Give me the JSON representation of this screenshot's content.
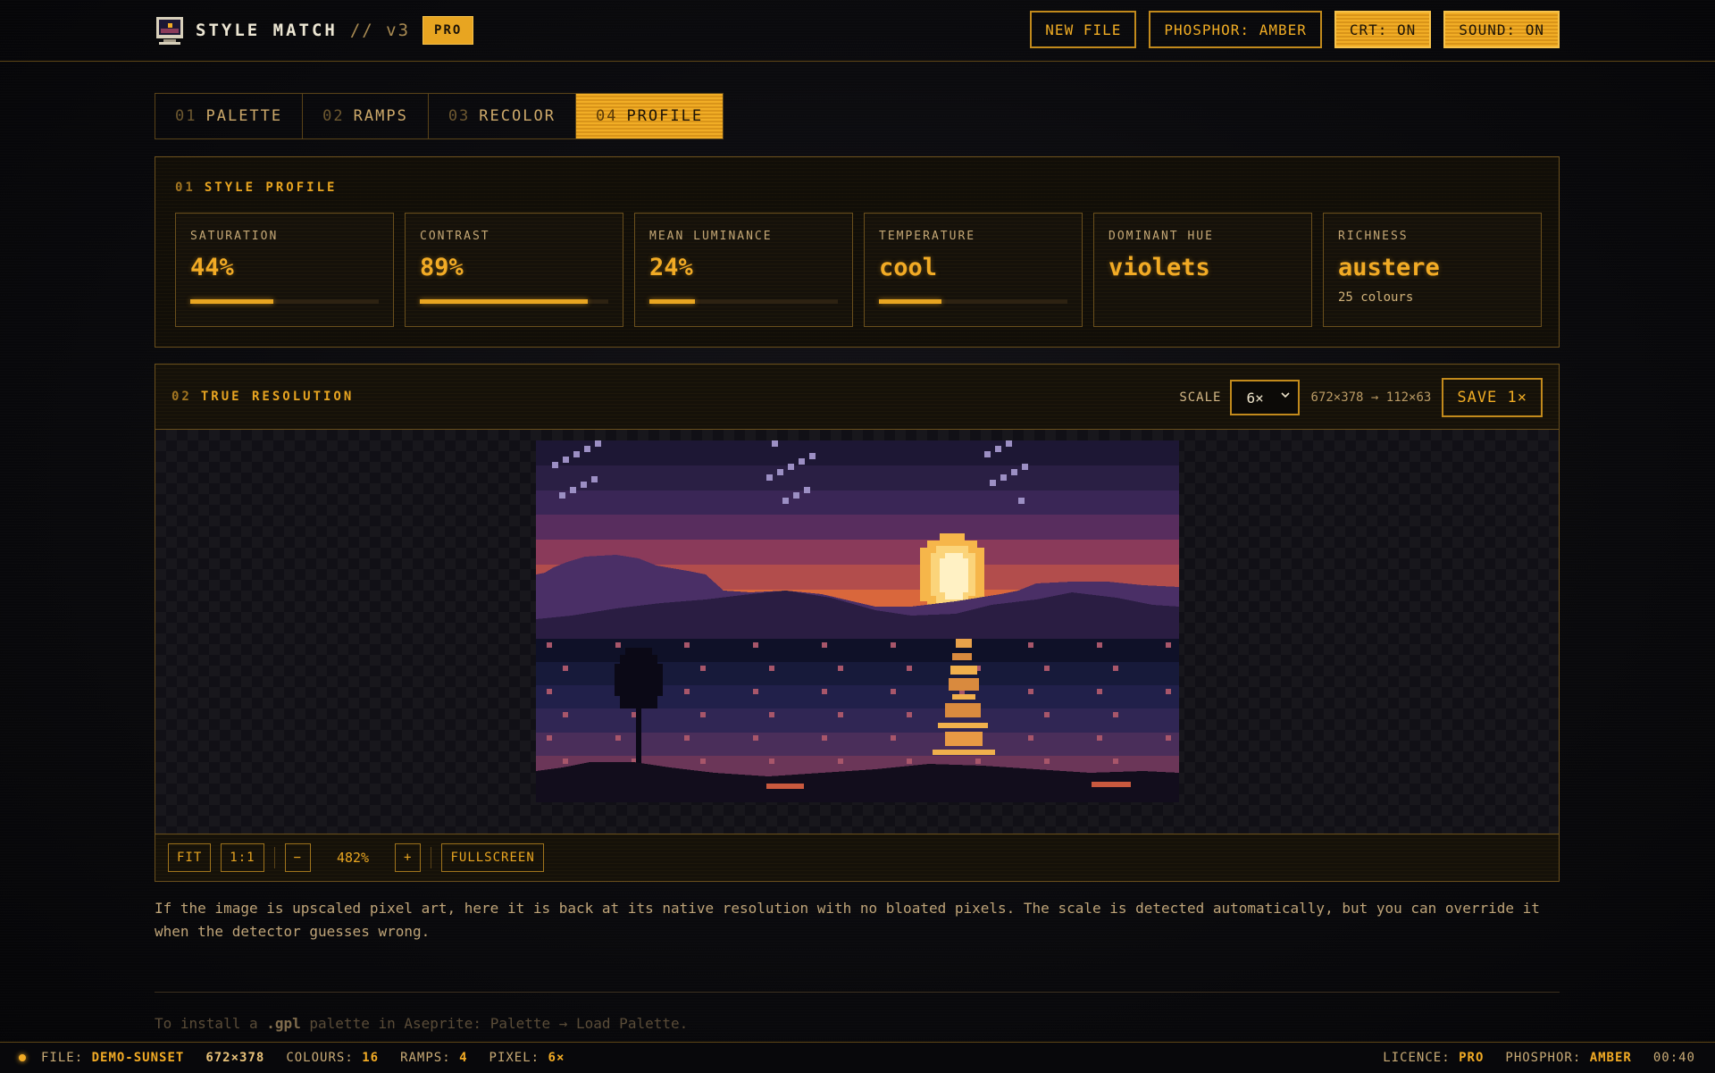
{
  "app": {
    "name": "STYLE MATCH",
    "version": "// v3",
    "badge": "PRO"
  },
  "top_buttons": {
    "new_file": "NEW FILE",
    "phosphor": "PHOSPHOR: AMBER",
    "crt": "CRT: ON",
    "sound": "SOUND: ON"
  },
  "tabs": [
    {
      "num": "01",
      "label": "PALETTE",
      "active": false
    },
    {
      "num": "02",
      "label": "RAMPS",
      "active": false
    },
    {
      "num": "03",
      "label": "RECOLOR",
      "active": false
    },
    {
      "num": "04",
      "label": "PROFILE",
      "active": true
    }
  ],
  "profile": {
    "num": "01",
    "title": "STYLE PROFILE",
    "stats": [
      {
        "label": "SATURATION",
        "value": "44%",
        "level": 0.44
      },
      {
        "label": "CONTRAST",
        "value": "89%",
        "level": 0.89
      },
      {
        "label": "MEAN LUMINANCE",
        "value": "24%",
        "level": 0.24
      },
      {
        "label": "TEMPERATURE",
        "value": "cool",
        "level": 0.33
      },
      {
        "label": "DOMINANT HUE",
        "value": "violets"
      },
      {
        "label": "RICHNESS",
        "value": "austere",
        "sub": "25 colours"
      }
    ]
  },
  "true_resolution": {
    "num": "02",
    "title": "TRUE RESOLUTION",
    "scale_label": "SCALE",
    "scale_value": "6×",
    "dims": "672×378 → 112×63",
    "save": "SAVE 1×",
    "footer": {
      "fit": "FIT",
      "one_to_one": "1:1",
      "zoom_out": "−",
      "zoom": "482%",
      "zoom_in": "+",
      "fullscreen": "FULLSCREEN"
    }
  },
  "description": "If the image is upscaled pixel art, here it is back at its native resolution with no bloated pixels. The scale is detected automatically, but you can override it when the detector guesses wrong.",
  "hint": {
    "before": "To install a ",
    "ext": ".gpl",
    "after": " palette in Aseprite: Palette → Load Palette."
  },
  "status": {
    "file_label": "FILE:",
    "file": "DEMO-SUNSET",
    "dims": "672×378",
    "colours_label": "COLOURS:",
    "colours": "16",
    "ramps_label": "RAMPS:",
    "ramps": "4",
    "pixel_label": "PIXEL:",
    "pixel": "6×",
    "licence_label": "LICENCE:",
    "licence": "PRO",
    "phosphor_label": "PHOSPHOR:",
    "phosphor": "AMBER",
    "time": "00:40"
  },
  "colors": {
    "accent": "#e8a521",
    "background": "#07070a",
    "art_sky": [
      "#1d1734",
      "#2a1f44",
      "#3a2656",
      "#582d5e",
      "#8a3a5a",
      "#b24d4c",
      "#d9673c",
      "#eb8a32"
    ],
    "art_water": [
      "#0f1128",
      "#171a3a",
      "#21204a",
      "#302654",
      "#4a2e5a",
      "#6b3658",
      "#8f4458"
    ]
  }
}
